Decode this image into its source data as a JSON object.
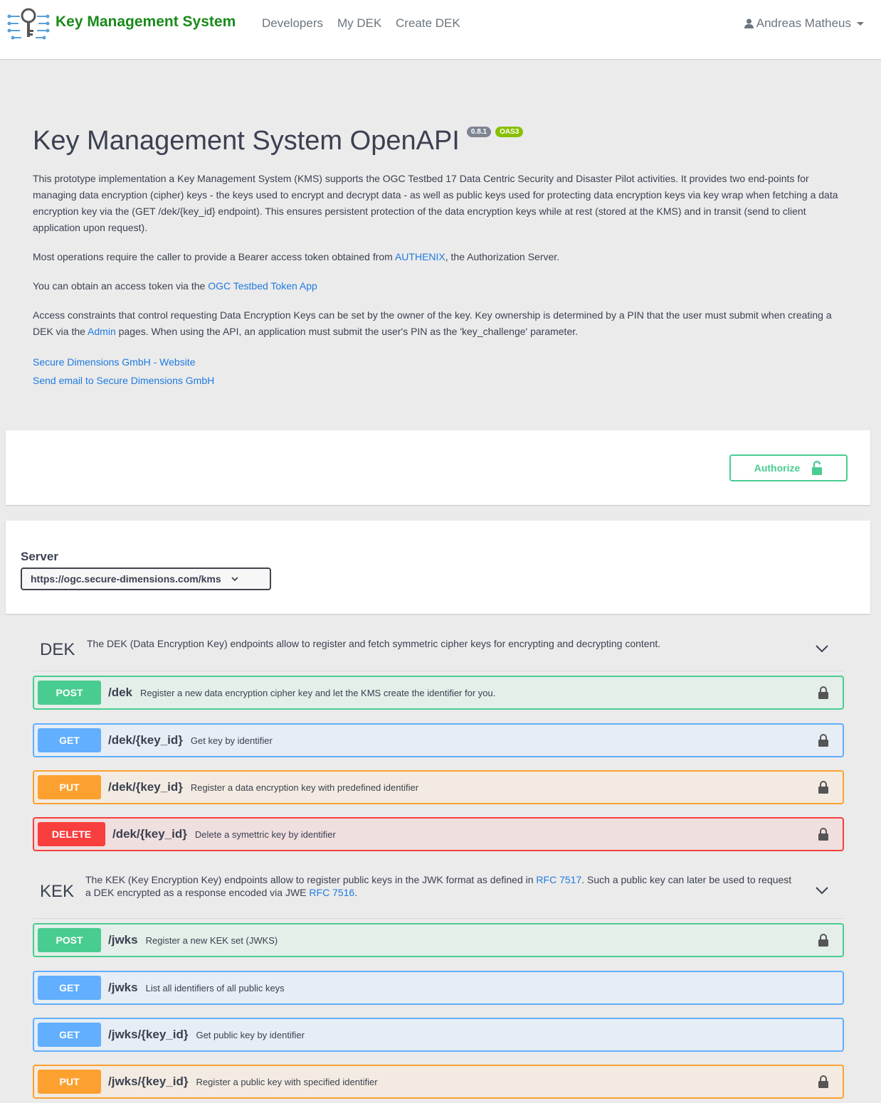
{
  "navbar": {
    "brand": "Key Management System",
    "links": [
      "Developers",
      "My DEK",
      "Create DEK"
    ],
    "user": "Andreas Matheus"
  },
  "info": {
    "title": "Key Management System OpenAPI",
    "version": "0.8.1",
    "oas": "OAS3",
    "p1": "This prototype implementation a Key Management System (KMS) supports the OGC Testbed 17 Data Centric Security and Disaster Pilot activities. It provides two end-points for managing data encryption (cipher) keys - the keys used to encrypt and decrypt data - as well as public keys used for protecting data encryption keys via key wrap when fetching a data encryption key via the (GET /dek/{key_id} endpoint). This ensures persistent protection of the data encryption keys while at rest (stored at the KMS) and in transit (send to client application upon request).",
    "p2_before": "Most operations require the caller to provide a Bearer access token obtained from ",
    "p2_link": "AUTHENIX",
    "p2_after": ", the Authorization Server.",
    "p3_before": "You can obtain an access token via the ",
    "p3_link": "OGC Testbed Token App",
    "p4_before": "Access constraints that control requesting Data Encryption Keys can be set by the owner of the key. Key ownership is determined by a PIN that the user must submit when creating a DEK via the ",
    "p4_link": "Admin",
    "p4_after": " pages. When using the API, an application must submit the user's PIN as the 'key_challenge' parameter.",
    "contact_website": "Secure Dimensions GmbH - Website",
    "contact_email": "Send email to Secure Dimensions GmbH"
  },
  "auth": {
    "button_label": "Authorize"
  },
  "server": {
    "label": "Server",
    "selected": "https://ogc.secure-dimensions.com/kms"
  },
  "tags": {
    "dek": {
      "name": "DEK",
      "description": "The DEK (Data Encryption Key) endpoints allow to register and fetch symmetric cipher keys for encrypting and decrypting content."
    },
    "kek": {
      "name": "KEK",
      "desc_part1": "The KEK (Key Encryption Key) endpoints allow to register public keys in the JWK format as defined in ",
      "link1": "RFC 7517",
      "desc_part2": ". Such a public key can later be used to request a DEK encrypted as a response encoded via JWE ",
      "link2": "RFC 7516",
      "desc_part3": "."
    }
  },
  "operations": [
    {
      "method": "POST",
      "path": "/dek",
      "summary": "Register a new data encryption cipher key and let the KMS create the identifier for you.",
      "locked": true
    },
    {
      "method": "GET",
      "path": "/dek/{key_id}",
      "summary": "Get key by identifier",
      "locked": true
    },
    {
      "method": "PUT",
      "path": "/dek/{key_id}",
      "summary": "Register a data encryption key with predefined identifier",
      "locked": true
    },
    {
      "method": "DELETE",
      "path": "/dek/{key_id}",
      "summary": "Delete a symettric key by identifier",
      "locked": true
    },
    {
      "method": "POST",
      "path": "/jwks",
      "summary": "Register a new KEK set (JWKS)",
      "locked": true
    },
    {
      "method": "GET",
      "path": "/jwks",
      "summary": "List all identifiers of all public keys",
      "locked": false
    },
    {
      "method": "GET",
      "path": "/jwks/{key_id}",
      "summary": "Get public key by identifier",
      "locked": false
    },
    {
      "method": "PUT",
      "path": "/jwks/{key_id}",
      "summary": "Register a public key with specified identifier",
      "locked": true
    }
  ],
  "colors": {
    "post": "#49cc90",
    "get": "#61affe",
    "put": "#fca130",
    "delete": "#f93e3e",
    "brand": "#1a8a1a",
    "link": "#1f7ae0"
  },
  "icons": {
    "logo": "key-circuit-logo",
    "user": "user-icon",
    "lock": "lock-icon",
    "unlocked": "unlock-icon",
    "chevron": "chevron-down-icon"
  }
}
